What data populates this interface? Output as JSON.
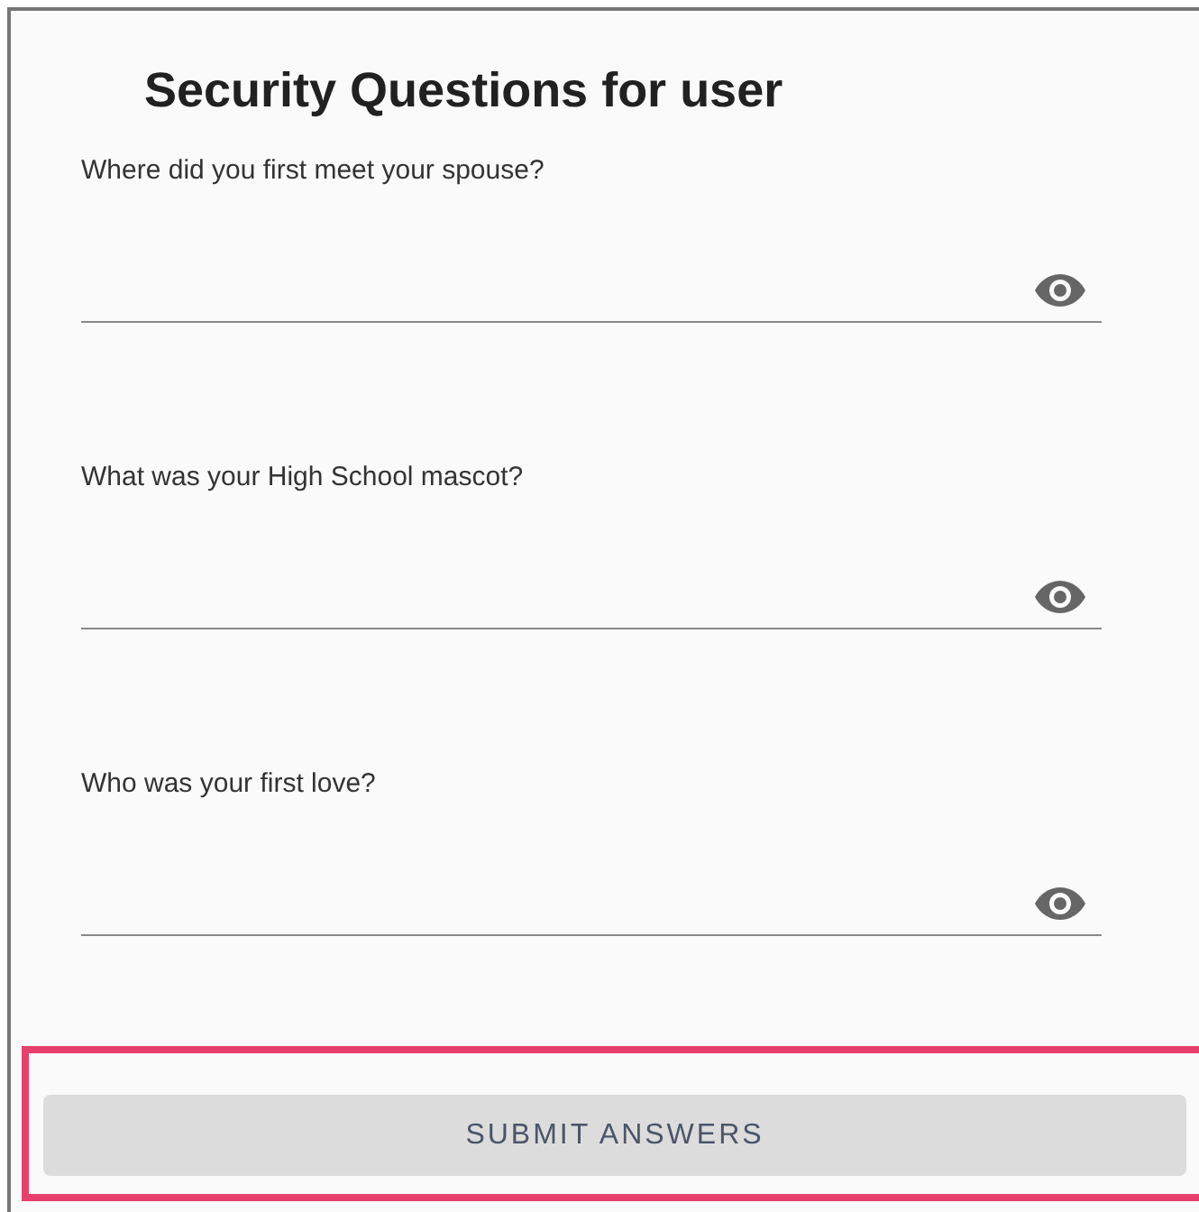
{
  "title": "Security Questions for user",
  "questions": [
    {
      "label": "Where did you first meet your spouse?"
    },
    {
      "label": "What was your High School mascot?"
    },
    {
      "label": "Who was your first love?"
    }
  ],
  "submit_button": {
    "label": "SUBMIT ANSWERS",
    "highlighted": true
  }
}
